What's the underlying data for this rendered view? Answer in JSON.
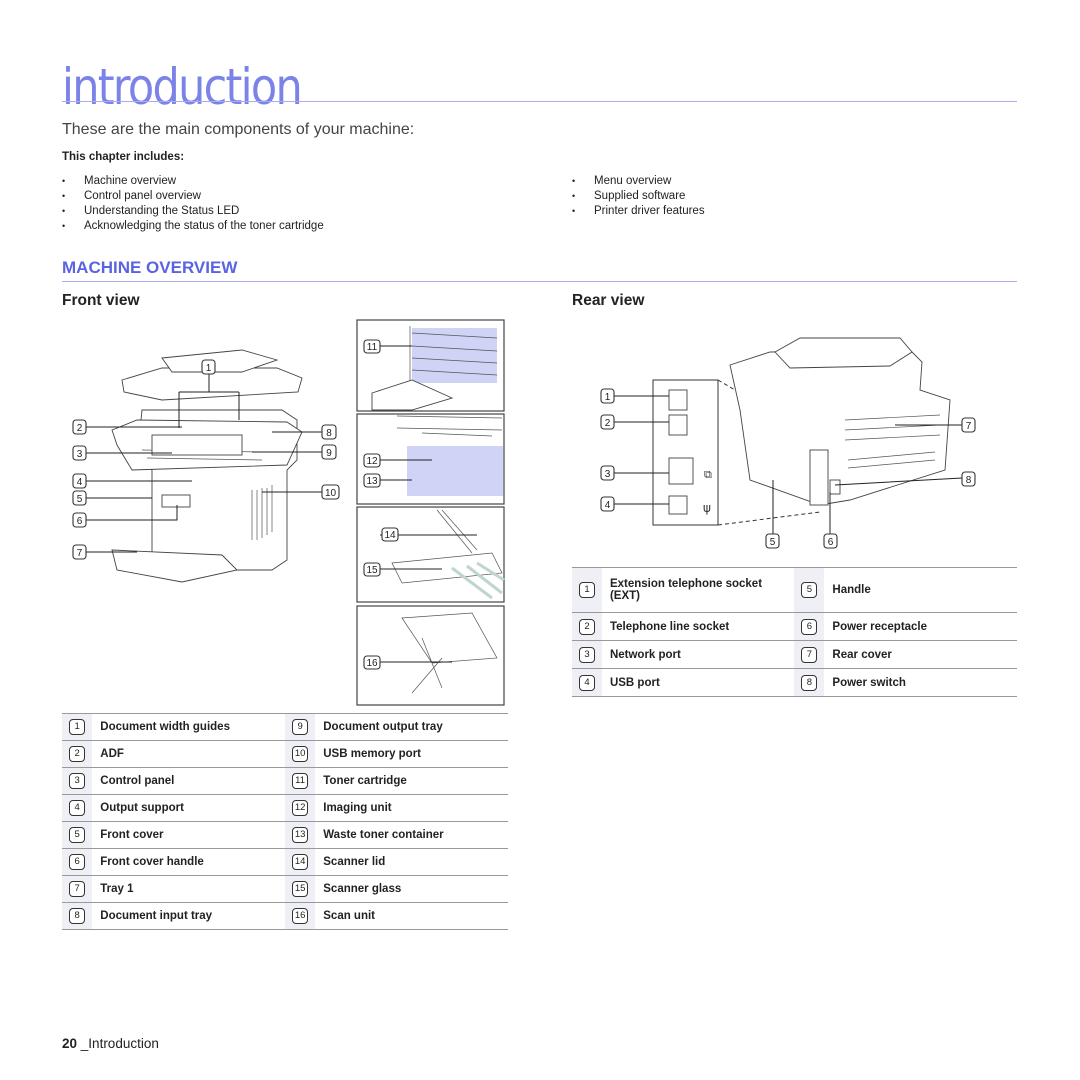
{
  "page": {
    "title": "introduction",
    "subtitle": "These are the main components of your machine:",
    "chapter_label": "This chapter includes:",
    "chapter_items_left": [
      "Machine overview",
      "Control panel overview",
      "Understanding the Status LED",
      "Acknowledging the status of the toner cartridge"
    ],
    "chapter_items_right": [
      "Menu overview",
      "Supplied software",
      "Printer driver features"
    ],
    "section_title": "MACHINE OVERVIEW",
    "accent_color": "#5a63e0",
    "footer": {
      "page_number": "20",
      "chapter": "_Introduction"
    }
  },
  "front_view": {
    "heading": "Front view",
    "callouts": [
      "1",
      "2",
      "3",
      "4",
      "5",
      "6",
      "7",
      "8",
      "9",
      "10",
      "11",
      "12",
      "13",
      "14",
      "15",
      "16"
    ],
    "parts": [
      {
        "num": "1",
        "label": "Document width guides"
      },
      {
        "num": "2",
        "label": "ADF"
      },
      {
        "num": "3",
        "label": "Control panel"
      },
      {
        "num": "4",
        "label": "Output support"
      },
      {
        "num": "5",
        "label": "Front cover"
      },
      {
        "num": "6",
        "label": "Front cover handle"
      },
      {
        "num": "7",
        "label": "Tray 1"
      },
      {
        "num": "8",
        "label": "Document input tray"
      },
      {
        "num": "9",
        "label": "Document output tray"
      },
      {
        "num": "10",
        "label": "USB memory port"
      },
      {
        "num": "11",
        "label": "Toner cartridge"
      },
      {
        "num": "12",
        "label": "Imaging unit"
      },
      {
        "num": "13",
        "label": "Waste toner container"
      },
      {
        "num": "14",
        "label": "Scanner lid"
      },
      {
        "num": "15",
        "label": "Scanner glass"
      },
      {
        "num": "16",
        "label": "Scan unit"
      }
    ]
  },
  "rear_view": {
    "heading": "Rear view",
    "callouts": [
      "1",
      "2",
      "3",
      "4",
      "5",
      "6",
      "7",
      "8"
    ],
    "parts": [
      {
        "num": "1",
        "label": "Extension telephone socket (EXT)"
      },
      {
        "num": "2",
        "label": "Telephone line socket"
      },
      {
        "num": "3",
        "label": "Network port"
      },
      {
        "num": "4",
        "label": "USB port"
      },
      {
        "num": "5",
        "label": "Handle"
      },
      {
        "num": "6",
        "label": "Power receptacle"
      },
      {
        "num": "7",
        "label": "Rear cover"
      },
      {
        "num": "8",
        "label": "Power switch"
      }
    ]
  }
}
